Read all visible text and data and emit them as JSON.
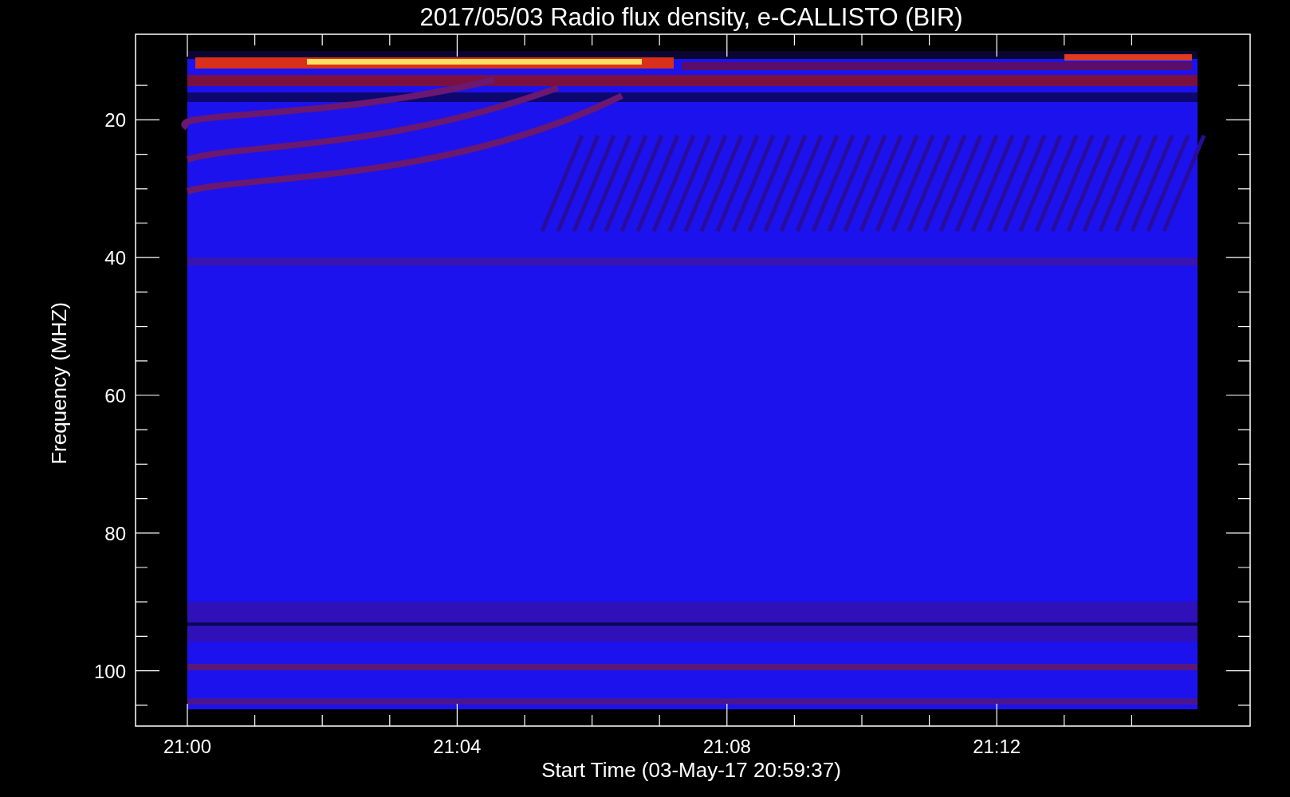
{
  "title": "2017/05/03  Radio flux density, e-CALLISTO (BIR)",
  "y_axis": {
    "label": "Frequency (MHZ)",
    "ticks": [
      "20",
      "40",
      "60",
      "80",
      "100"
    ]
  },
  "x_axis": {
    "label": "Start Time (03-May-17 20:59:37)",
    "ticks": [
      "21:00",
      "21:04",
      "21:08",
      "21:12"
    ]
  }
}
